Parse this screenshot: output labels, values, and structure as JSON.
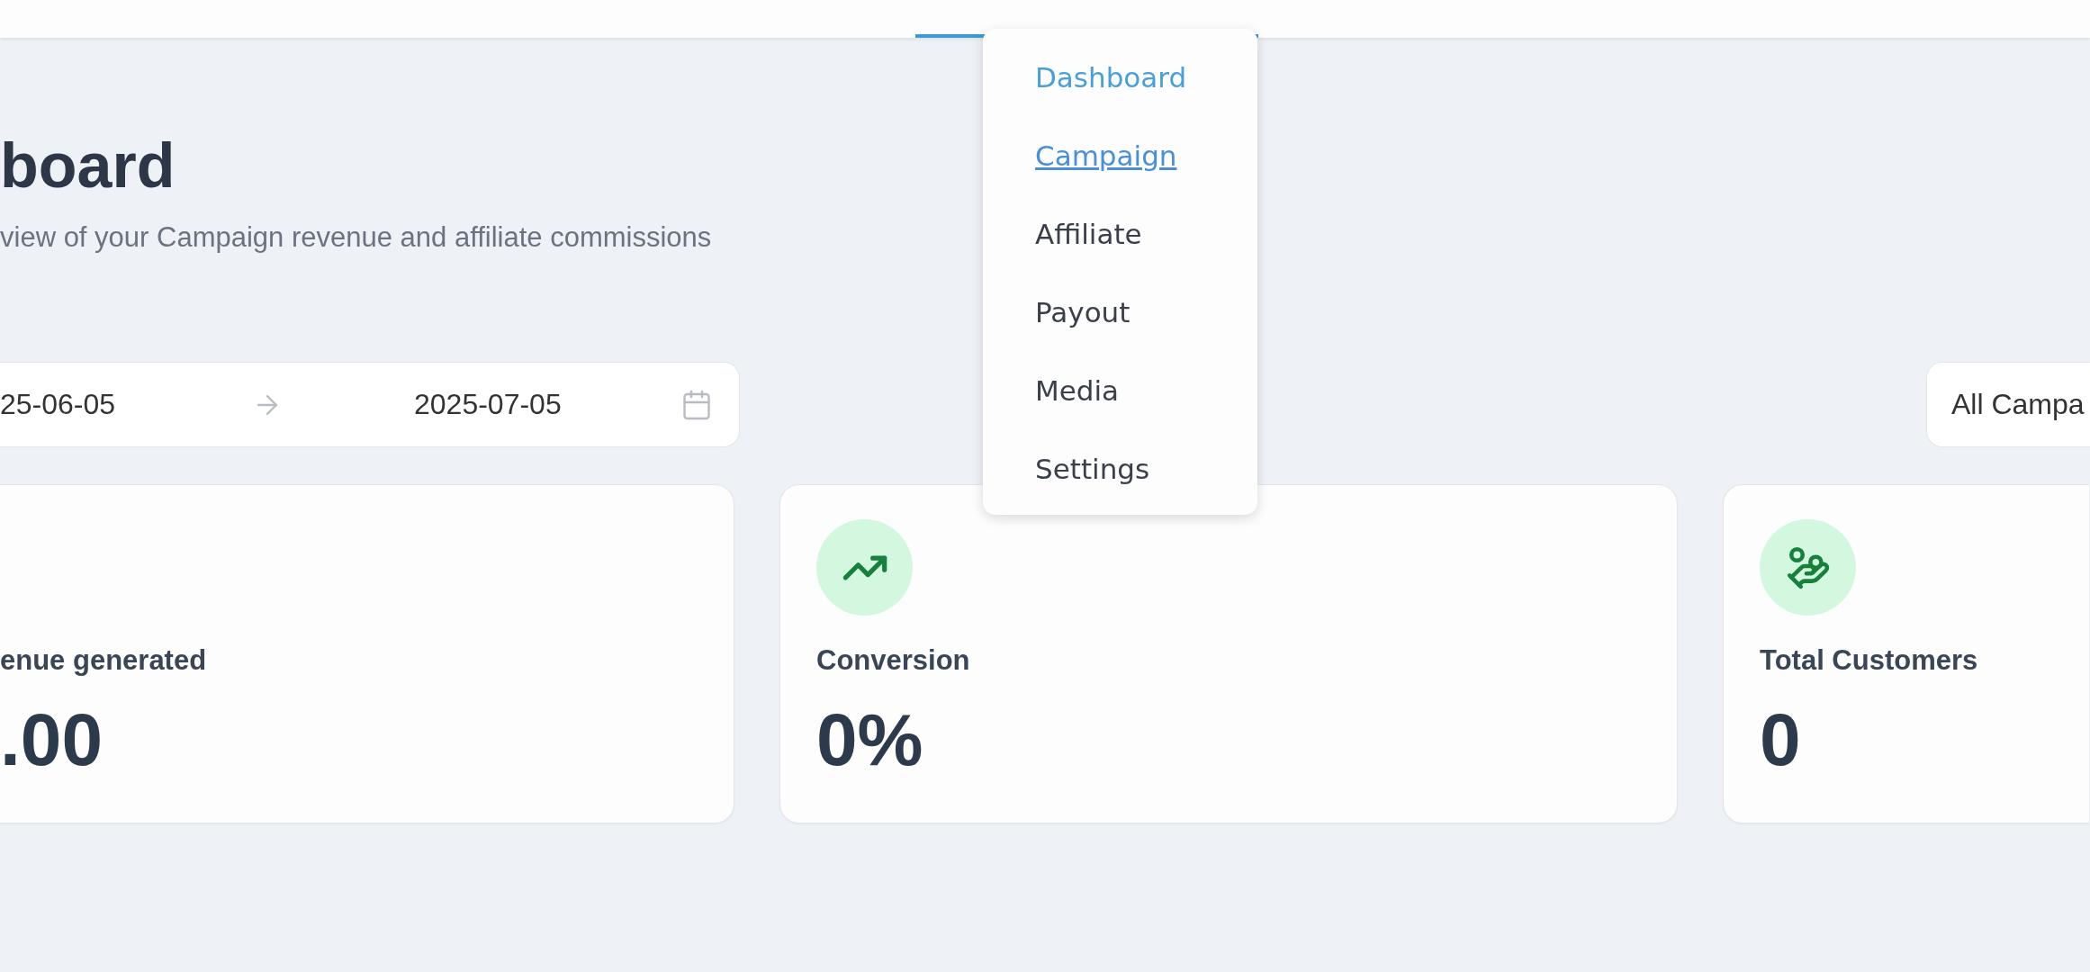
{
  "top_nav": {
    "tabs": [
      {
        "selected": true
      }
    ]
  },
  "menu": {
    "items": [
      {
        "label": "Dashboard",
        "selected": true,
        "hovered": false
      },
      {
        "label": "Campaign",
        "selected": false,
        "hovered": true
      },
      {
        "label": "Affiliate",
        "selected": false,
        "hovered": false
      },
      {
        "label": "Payout",
        "selected": false,
        "hovered": false
      },
      {
        "label": "Media",
        "selected": false,
        "hovered": false
      },
      {
        "label": "Settings",
        "selected": false,
        "hovered": false
      }
    ]
  },
  "header": {
    "title": "board",
    "subtitle": "view of your Campaign revenue and affiliate commissions"
  },
  "filters": {
    "start_date": "25-06-05",
    "end_date": "2025-07-05",
    "campaign_select": "All Campa"
  },
  "stats": [
    {
      "kind": "plain",
      "label": "enue generated",
      "value": ".00"
    },
    {
      "kind": "trend",
      "label": "Conversion",
      "value": "0%"
    },
    {
      "kind": "coins",
      "label": "Total Customers",
      "value": "0"
    }
  ]
}
